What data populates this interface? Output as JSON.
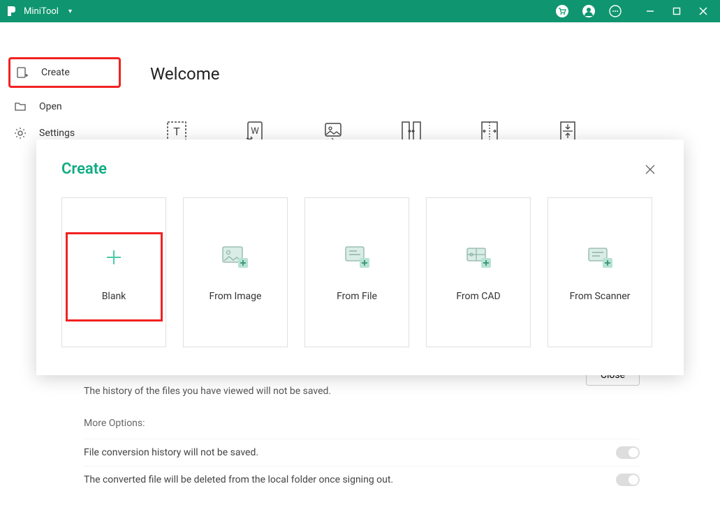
{
  "titlebar": {
    "app_name": "MiniTool"
  },
  "sidebar": {
    "items": [
      {
        "label": "Create"
      },
      {
        "label": "Open"
      },
      {
        "label": "Settings"
      }
    ]
  },
  "welcome": {
    "title": "Welcome"
  },
  "modal": {
    "title": "Create",
    "cards": [
      {
        "label": "Blank"
      },
      {
        "label": "From Image"
      },
      {
        "label": "From File"
      },
      {
        "label": "From CAD"
      },
      {
        "label": "From Scanner"
      }
    ]
  },
  "bottom": {
    "history_desc": "The history of the files you have viewed will not be saved.",
    "more_options": "More Options:",
    "opt1": "File conversion history will not be saved.",
    "opt2": "The converted file will be deleted from the local folder once signing out.",
    "close": "Close"
  }
}
